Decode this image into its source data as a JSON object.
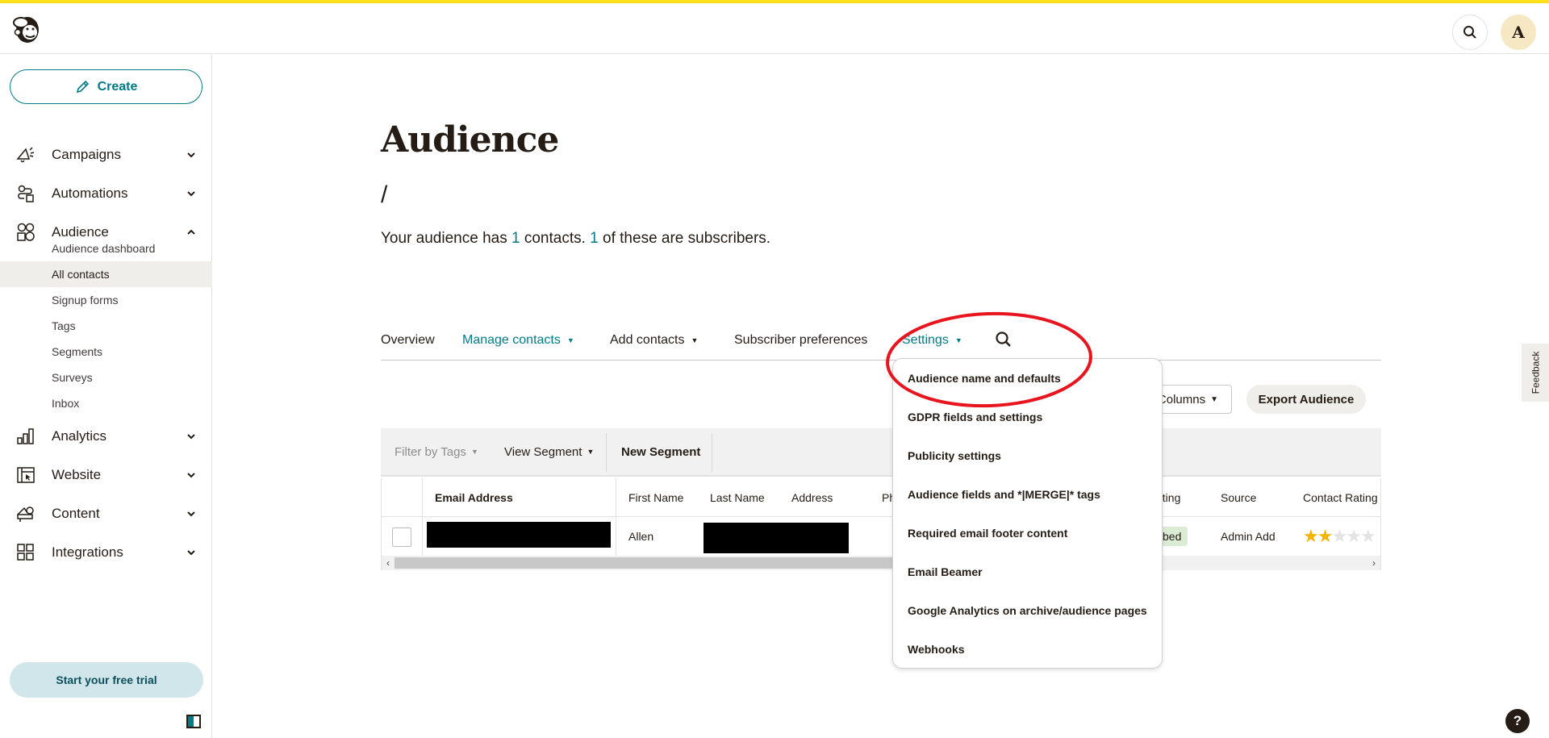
{
  "header": {
    "logo_icon": "mailchimp-freddie-logo",
    "search_icon": "search-icon",
    "avatar_initial": "A"
  },
  "colors": {
    "accent_yellow": "#ffe01b",
    "brand_teal": "#007c89",
    "annotation_red": "#e8141e",
    "star_gold": "#f6b400"
  },
  "sidebar": {
    "create_label": "Create",
    "nav": [
      {
        "label": "Campaigns",
        "icon": "megaphone-icon",
        "expanded": false
      },
      {
        "label": "Automations",
        "icon": "automation-flow-icon",
        "expanded": false
      },
      {
        "label": "Audience",
        "icon": "audience-icon",
        "expanded": true
      },
      {
        "label": "Analytics",
        "icon": "bar-chart-icon",
        "expanded": false
      },
      {
        "label": "Website",
        "icon": "website-icon",
        "expanded": false
      },
      {
        "label": "Content",
        "icon": "content-icon",
        "expanded": false
      },
      {
        "label": "Integrations",
        "icon": "grid-icon",
        "expanded": false
      }
    ],
    "audience_sub": [
      {
        "label": "Audience dashboard",
        "active": false
      },
      {
        "label": "All contacts",
        "active": true
      },
      {
        "label": "Signup forms",
        "active": false
      },
      {
        "label": "Tags",
        "active": false
      },
      {
        "label": "Segments",
        "active": false
      },
      {
        "label": "Surveys",
        "active": false
      },
      {
        "label": "Inbox",
        "active": false
      }
    ],
    "trial_label": "Start your free trial"
  },
  "main": {
    "title": "Audience",
    "breadcrumb_slash": "/",
    "summary": {
      "prefix": "Your audience has ",
      "contacts": "1",
      "middle": " contacts. ",
      "subscribers": "1",
      "suffix": " of these are subscribers."
    },
    "tabs": [
      {
        "label": "Overview",
        "dropdown": false,
        "active": false
      },
      {
        "label": "Manage contacts",
        "dropdown": true,
        "active": true
      },
      {
        "label": "Add contacts",
        "dropdown": true,
        "active": false
      },
      {
        "label": "Subscriber preferences",
        "dropdown": false,
        "active": false
      },
      {
        "label": "Settings",
        "dropdown": true,
        "active": true
      }
    ],
    "columns_label": "Columns",
    "export_label": "Export Audience",
    "filterbar": {
      "filter_tags": "Filter by Tags",
      "view_segment": "View Segment",
      "new_segment": "New Segment"
    },
    "table": {
      "headers": [
        "Email Address",
        "First Name",
        "Last Name",
        "Address",
        "Ph",
        "eting",
        "Source",
        "Contact Rating"
      ],
      "rows": [
        {
          "email": "[redacted]",
          "first_name": "Allen",
          "last_name": "[redacted]",
          "status": "bed",
          "source": "Admin Add",
          "rating": 2,
          "rating_max": 5
        }
      ]
    }
  },
  "settings_dropdown": {
    "items": [
      "Audience name and defaults",
      "GDPR fields and settings",
      "Publicity settings",
      "Audience fields and *|MERGE|* tags",
      "Required email footer content",
      "Email Beamer",
      "Google Analytics on archive/audience pages",
      "Webhooks"
    ]
  },
  "feedback_label": "Feedback",
  "help_label": "?"
}
